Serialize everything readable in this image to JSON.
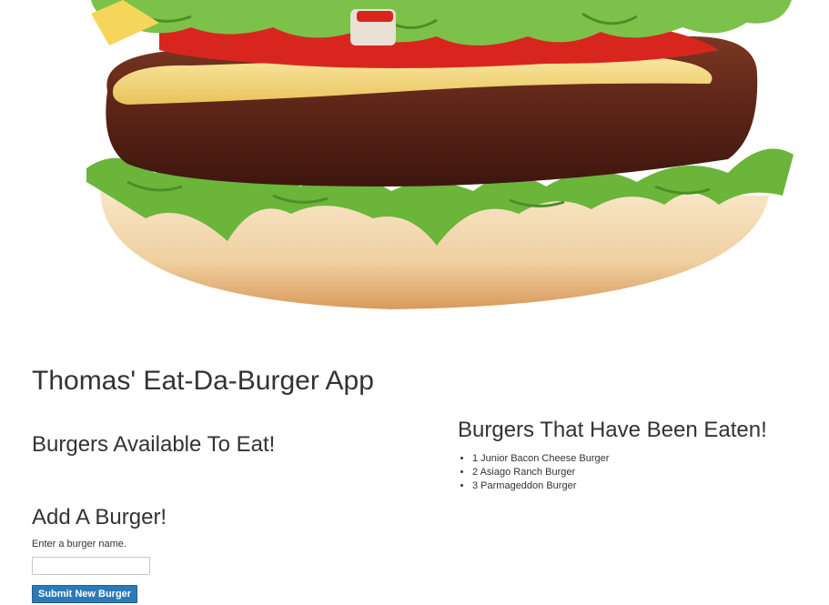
{
  "app": {
    "title": "Thomas' Eat-Da-Burger App"
  },
  "available": {
    "heading": "Burgers Available To Eat!"
  },
  "eaten": {
    "heading": "Burgers That Have Been Eaten!",
    "items": [
      {
        "label": "1 Junior Bacon Cheese Burger"
      },
      {
        "label": "2 Asiago Ranch Burger"
      },
      {
        "label": "3 Parmageddon Burger"
      }
    ]
  },
  "add_form": {
    "heading": "Add A Burger!",
    "hint": "Enter a burger name.",
    "input_value": "",
    "submit_label": "Submit New Burger"
  },
  "colors": {
    "button": "#2a7ab8",
    "text": "#333333",
    "bun": "#efc999",
    "patty": "#5a2618",
    "lettuce": "#6ab53a",
    "tomato": "#d8261f",
    "cheese": "#f5d65a"
  },
  "hero": {
    "image_name": "burger-hero-image"
  }
}
